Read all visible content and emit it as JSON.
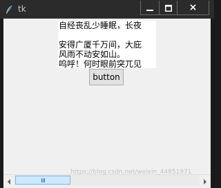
{
  "window": {
    "title": "tk",
    "app_icon": "feather-icon",
    "titlebar_color": "#2b2b2b",
    "controls": {
      "minimize": "minimize-icon",
      "maximize": "maximize-icon",
      "close": "×"
    }
  },
  "text_widget": {
    "lines": [
      "自经丧乱少睡眠，长夜",
      "",
      "安得广厦千万间，大庇",
      "风雨不动安如山。",
      "呜呼！何时眼前突兀见"
    ]
  },
  "button": {
    "label": "button"
  },
  "scrollbar": {
    "orientation": "horizontal",
    "visible_fraction": 0.3,
    "position_fraction": 0.0
  },
  "watermark": {
    "text": "https://blog.csdn.net/weixin_44851971"
  }
}
